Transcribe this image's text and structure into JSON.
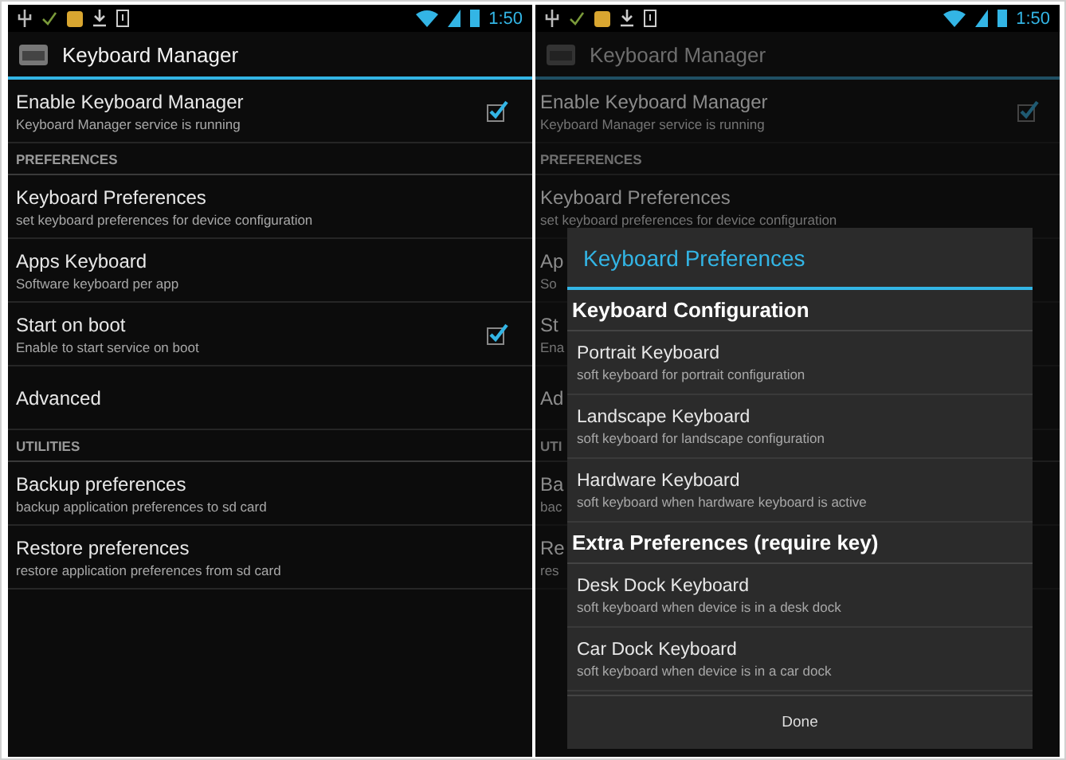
{
  "screens": [
    {
      "dimmed": false,
      "status_bar": {
        "time": "1:50"
      },
      "action_bar": {
        "title": "Keyboard Manager"
      },
      "items": [
        {
          "kind": "item",
          "title": "Enable Keyboard Manager",
          "summary": "Keyboard Manager service is running",
          "checkbox": true,
          "checked": true
        },
        {
          "kind": "header",
          "title": "PREFERENCES"
        },
        {
          "kind": "item",
          "title": "Keyboard Preferences",
          "summary": "set keyboard preferences for device configuration"
        },
        {
          "kind": "item",
          "title": "Apps Keyboard",
          "summary": "Software keyboard per app"
        },
        {
          "kind": "item",
          "title": "Start on boot",
          "summary": "Enable to start service on boot",
          "checkbox": true,
          "checked": true
        },
        {
          "kind": "item",
          "title": "Advanced"
        },
        {
          "kind": "header",
          "title": "UTILITIES"
        },
        {
          "kind": "item",
          "title": "Backup preferences",
          "summary": "backup application preferences to sd card"
        },
        {
          "kind": "item",
          "title": "Restore preferences",
          "summary": "restore application preferences from sd card"
        }
      ]
    },
    {
      "dimmed": true,
      "status_bar": {
        "time": "1:50"
      },
      "action_bar": {
        "title": "Keyboard Manager"
      },
      "items": [
        {
          "kind": "item",
          "title": "Enable Keyboard Manager",
          "summary": "Keyboard Manager service is running",
          "checkbox": true,
          "checked": true
        },
        {
          "kind": "header",
          "title": "PREFERENCES"
        },
        {
          "kind": "item",
          "title": "Keyboard Preferences",
          "summary": "set keyboard preferences for device configuration"
        },
        {
          "kind": "item",
          "title": "Ap",
          "summary": "So"
        },
        {
          "kind": "item",
          "title": "St",
          "summary": "Ena"
        },
        {
          "kind": "item",
          "title": "Ad"
        },
        {
          "kind": "header",
          "title": "UTI"
        },
        {
          "kind": "item",
          "title": "Ba",
          "summary": "bac"
        },
        {
          "kind": "item",
          "title": "Re",
          "summary": "res"
        }
      ]
    }
  ],
  "dialog": {
    "title": "Keyboard Preferences",
    "items": [
      {
        "kind": "header",
        "title": "Keyboard Configuration"
      },
      {
        "kind": "item",
        "title": "Portrait Keyboard",
        "summary": "soft keyboard for portrait configuration"
      },
      {
        "kind": "item",
        "title": "Landscape Keyboard",
        "summary": "soft keyboard for landscape configuration"
      },
      {
        "kind": "item",
        "title": "Hardware Keyboard",
        "summary": "soft keyboard when hardware keyboard is active"
      },
      {
        "kind": "header",
        "title": "Extra Preferences (require key)"
      },
      {
        "kind": "item",
        "title": "Desk Dock Keyboard",
        "summary": "soft keyboard when device is in a desk dock"
      },
      {
        "kind": "item",
        "title": "Car Dock Keyboard",
        "summary": "soft keyboard when device is in a car dock"
      }
    ],
    "button": "Done"
  }
}
